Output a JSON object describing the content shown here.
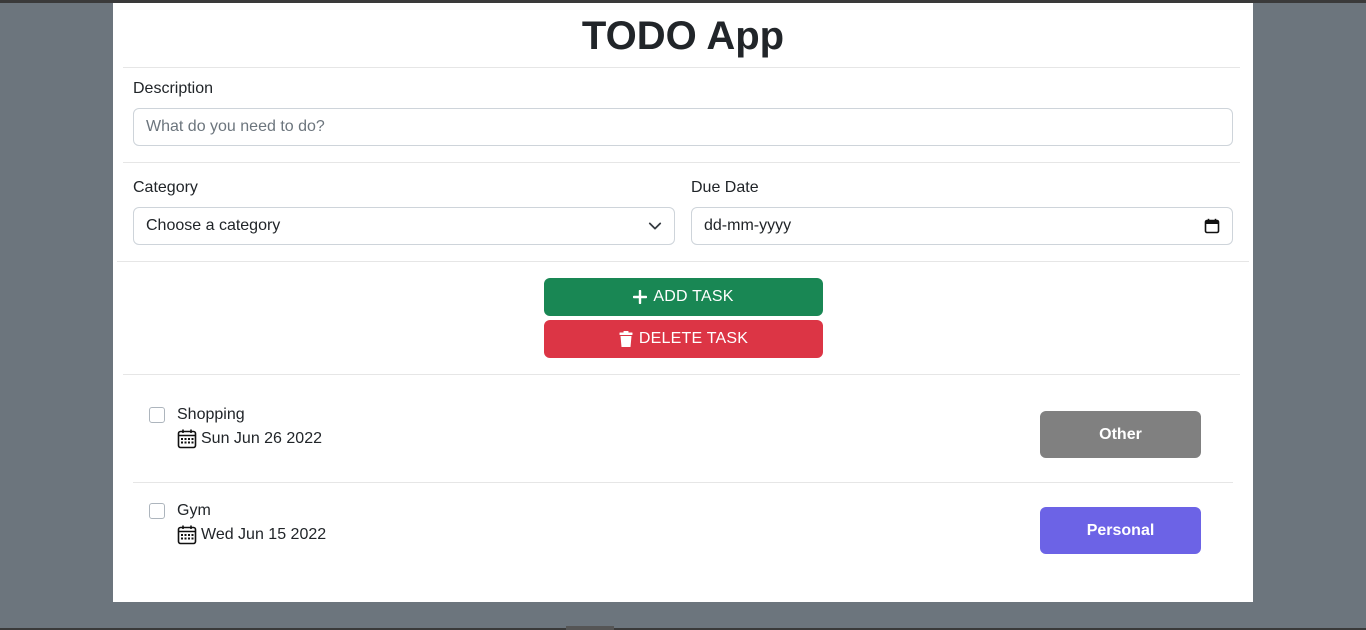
{
  "app": {
    "title": "TODO App"
  },
  "form": {
    "description_label": "Description",
    "description_placeholder": "What do you need to do?",
    "category_label": "Category",
    "category_selected": "Choose a category",
    "due_date_label": "Due Date",
    "due_date_placeholder": "dd-mm-yyyy"
  },
  "actions": {
    "add_label": "ADD TASK",
    "delete_label": "DELETE TASK",
    "add_color": "#198754",
    "delete_color": "#dc3545"
  },
  "tasks": [
    {
      "name": "Shopping",
      "date": "Sun Jun 26 2022",
      "category": "Other",
      "color": "#808080",
      "checked": false
    },
    {
      "name": "Gym",
      "date": "Wed Jun 15 2022",
      "category": "Personal",
      "color": "#6c63e6",
      "checked": false
    }
  ],
  "icons": {
    "plus": "plus-icon",
    "trash": "trash-icon",
    "calendar": "calendar-icon",
    "chevron": "chevron-down-icon"
  }
}
